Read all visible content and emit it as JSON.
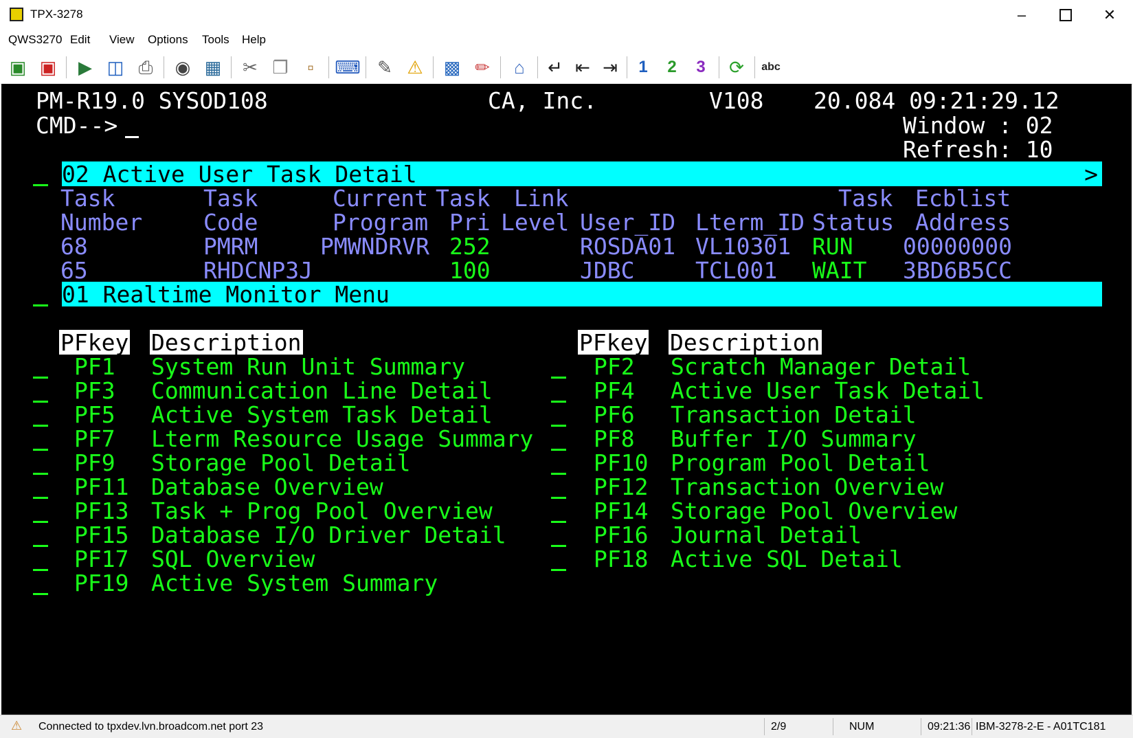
{
  "window": {
    "title": "TPX-3278"
  },
  "menu": [
    "QWS3270",
    "Edit",
    "View",
    "Options",
    "Tools",
    "Help"
  ],
  "toolbar_icons": [
    "connect-icon",
    "disconnect-icon",
    "play-macro-icon",
    "screen-save-icon",
    "print-icon",
    "camera-icon",
    "copy-screen-icon",
    "cut-icon",
    "copy-icon",
    "paste-icon",
    "keyboard-icon",
    "edit-icon",
    "warning-icon",
    "monitor-icon",
    "eraser-icon",
    "home-icon",
    "enter-icon",
    "backtab-icon",
    "tab-icon",
    "pa1-icon",
    "pa2-icon",
    "pa3-icon",
    "refresh-icon",
    "spellcheck-icon"
  ],
  "pa_labels": {
    "pa1": "1",
    "pa2": "2",
    "pa3": "3"
  },
  "spell_label": "abc",
  "terminal": {
    "system": "PM-R19.0 SYSOD108",
    "company": "CA, Inc.",
    "version": "V108",
    "datetime": "20.084 09:21:29.12",
    "cmd_prompt": "CMD-->",
    "window_label": "Window : 02",
    "refresh_label": "Refresh: 10",
    "section1_title": "02 Active User Task Detail",
    "section1_more": ">",
    "task_headers": {
      "task_number": [
        "Task",
        "Number"
      ],
      "task_code": [
        "Task",
        "Code"
      ],
      "current_program": [
        "Current",
        "Program"
      ],
      "task_pri": [
        "Task",
        "Pri"
      ],
      "link_level": [
        "Link",
        "Level"
      ],
      "user_id": "User_ID",
      "lterm_id": "Lterm_ID",
      "task_status": [
        "Task",
        "Status"
      ],
      "ecblist": [
        "Ecblist",
        "Address"
      ]
    },
    "tasks": [
      {
        "number": "68",
        "code": "PMRM",
        "program": "PMWNDRVR",
        "pri": "252",
        "user": "ROSDA01",
        "lterm": "VL10301",
        "status": "RUN",
        "ecb": "00000000"
      },
      {
        "number": "65",
        "code": "RHDCNP3J",
        "program": "",
        "pri": "100",
        "user": "JDBC",
        "lterm": "TCL001",
        "status": "WAIT",
        "ecb": "3BD6B5CC"
      }
    ],
    "section2_title": "01 Realtime Monitor Menu",
    "pf_header_key": "PFkey",
    "pf_header_desc": "Description",
    "pf_left": [
      {
        "key": "PF1",
        "desc": "System Run Unit Summary"
      },
      {
        "key": "PF3",
        "desc": "Communication Line Detail"
      },
      {
        "key": "PF5",
        "desc": "Active System Task Detail"
      },
      {
        "key": "PF7",
        "desc": "Lterm Resource Usage Summary"
      },
      {
        "key": "PF9",
        "desc": "Storage Pool Detail"
      },
      {
        "key": "PF11",
        "desc": "Database Overview"
      },
      {
        "key": "PF13",
        "desc": "Task + Prog Pool Overview"
      },
      {
        "key": "PF15",
        "desc": "Database I/O Driver Detail"
      },
      {
        "key": "PF17",
        "desc": "SQL Overview"
      },
      {
        "key": "PF19",
        "desc": "Active System Summary"
      }
    ],
    "pf_right": [
      {
        "key": "PF2",
        "desc": "Scratch Manager Detail"
      },
      {
        "key": "PF4",
        "desc": "Active User Task Detail"
      },
      {
        "key": "PF6",
        "desc": "Transaction Detail"
      },
      {
        "key": "PF8",
        "desc": "Buffer I/O Summary"
      },
      {
        "key": "PF10",
        "desc": "Program Pool Detail"
      },
      {
        "key": "PF12",
        "desc": "Transaction Overview"
      },
      {
        "key": "PF14",
        "desc": "Storage Pool Overview"
      },
      {
        "key": "PF16",
        "desc": "Journal Detail"
      },
      {
        "key": "PF18",
        "desc": "Active SQL Detail"
      }
    ]
  },
  "status": {
    "connection": "Connected to tpxdev.lvn.broadcom.net port 23",
    "position": "2/9",
    "num": "NUM",
    "time": "09:21:36",
    "terminal": "IBM-3278-2-E - A01TC181"
  },
  "colors": {
    "terminal_bg": "#000000",
    "field_green": "#19ff19",
    "field_blue": "#8a8cff",
    "bar_cyan": "#00ffff",
    "text_white": "#ffffff"
  }
}
